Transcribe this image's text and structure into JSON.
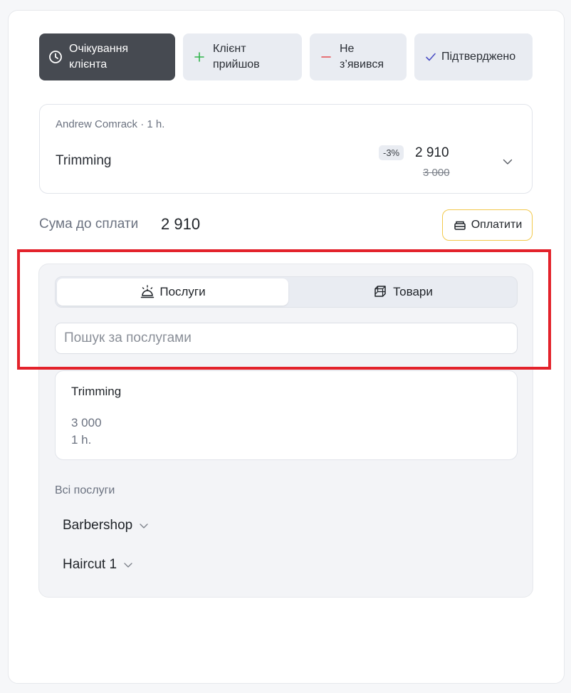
{
  "status_buttons": [
    {
      "label": "Очікування\nклієнта",
      "icon": "clock-icon",
      "active": true
    },
    {
      "label": "Клієнт\nприйшов",
      "icon": "plus-icon",
      "active": false,
      "icon_color": "#2fb34a"
    },
    {
      "label": "Не\nз’явився",
      "icon": "minus-icon",
      "active": false,
      "icon_color": "#e5484d"
    },
    {
      "label": "Підтверджено",
      "icon": "check-icon",
      "active": false,
      "icon_color": "#4b4fc4"
    }
  ],
  "service_card": {
    "meta": "Andrew Comrack · 1 h.",
    "name": "Trimming",
    "discount": "-3%",
    "price": "2 910",
    "old_price": "3 000"
  },
  "summary": {
    "label": "Сума до сплати",
    "value": "2 910",
    "pay_label": "Оплатити"
  },
  "panel": {
    "tabs": [
      {
        "label": "Послуги",
        "icon": "service-bell-icon",
        "active": true
      },
      {
        "label": "Товари",
        "icon": "box-icon",
        "active": false
      }
    ],
    "search_placeholder": "Пошук за послугами",
    "result": {
      "name": "Trimming",
      "price": "3 000",
      "duration": "1 h."
    },
    "all_label": "Всі послуги",
    "categories": [
      {
        "label": "Barbershop"
      },
      {
        "label": "Haircut 1"
      }
    ]
  },
  "colors": {
    "highlight": "#e3222b",
    "pay_border": "#f2c94c",
    "active_status": "#464a51"
  }
}
